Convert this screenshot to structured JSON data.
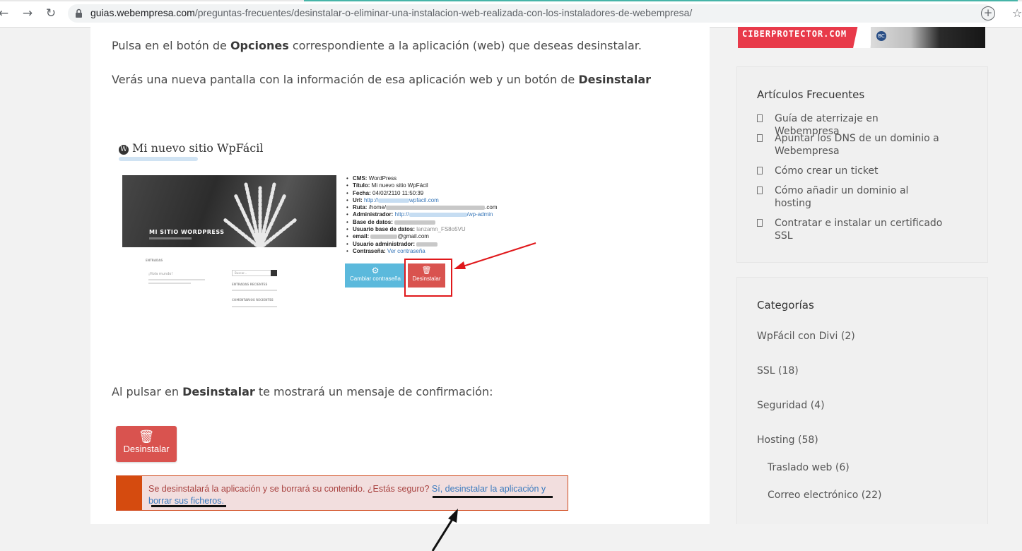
{
  "browser": {
    "url_host": "guias.webempresa.com",
    "url_path": "/preguntas-frecuentes/desinstalar-o-eliminar-una-instalacion-web-realizada-con-los-instaladores-de-webempresa/"
  },
  "article": {
    "p1": {
      "before": "Pulsa en el botón de ",
      "bold": "Opciones",
      "after": " correspondiente a la aplicación (web) que deseas desinstalar."
    },
    "p2": {
      "before": "Verás una nueva pantalla con la información de esa aplicación web y un botón de ",
      "bold": "Desinstalar"
    },
    "p3": {
      "before": "Al pulsar en ",
      "bold": "Desinstalar",
      "after": " te mostrará un mensaje de confirmación:"
    }
  },
  "screenshot1": {
    "site_title": "Mi nuevo sitio WpFácil",
    "hero_caption": "MI SITIO WORDPRESS",
    "mini": {
      "entradas": "ENTRADAS",
      "post_title": "¡Hola mundo!",
      "recent": "ENTRADAS RECIENTES",
      "comments": "COMENTARIOS RECIENTES",
      "search": "Buscar..."
    },
    "info": {
      "cms_label": "CMS:",
      "cms_value": "WordPress",
      "titulo_label": "Título:",
      "titulo_value": "Mi nuevo sitio WpFácil",
      "fecha_label": "Fecha:",
      "fecha_value": "04/02/2110 11:50:39",
      "url_label": "Url:",
      "url_pre": "http://",
      "url_post": "wpfacil.com",
      "ruta_label": "Ruta:",
      "ruta_pre": "/home/",
      "ruta_post": ".com",
      "admin_label": "Administrador:",
      "admin_pre": "http://",
      "admin_post": "/wp-admin",
      "bd_label": "Base de datos:",
      "ubd_label": "Usuario base de datos:",
      "ubd_value": "lanzamn_FS8o5VU",
      "email_label": "email:",
      "email_value": "@gmail.com",
      "uadmin_label": "Usuario administrador:",
      "pass_label": "Contraseña:",
      "pass_link": "Ver contraseña"
    },
    "btn_cambiar": "Cambiar contraseña",
    "btn_desinstalar": "Desinstalar"
  },
  "screenshot2": {
    "btn_desinstalar": "Desinstalar",
    "alert_text": "Se desinstalará la aplicación y se borrará su contenido. ¿Estás seguro? ",
    "alert_link": "Sí, desinstalar la aplicación y borrar sus ficheros."
  },
  "sidebar": {
    "ad_text": "CIBERPROTECTOR.COM",
    "faq": {
      "title": "Artículos Frecuentes",
      "items": [
        "Guía de aterrizaje en Webempresa",
        "Apuntar los DNS de un dominio a Webempresa",
        "Cómo crear un ticket",
        "Cómo añadir un dominio al hosting",
        "Contratar e instalar un certificado SSL"
      ]
    },
    "categories": {
      "title": "Categorías",
      "items": [
        "WpFácil con Divi (2)",
        "SSL (18)",
        "Seguridad (4)",
        "Hosting (58)",
        "Traslado web (6)",
        "Correo electrónico (22)"
      ]
    }
  },
  "colors": {
    "accent_red": "#d9534f",
    "highlight_red": "#e0181b",
    "link_blue": "#3b7bbf",
    "alert_bg": "#f2dede",
    "tab_accent": "#46b4a8"
  },
  "icons": [
    "back-arrow-icon",
    "forward-arrow-icon",
    "reload-icon",
    "lock-icon",
    "add-icon",
    "star-icon",
    "gear-icon",
    "trash-icon",
    "wordpress-logo-icon",
    "square-bullet-icon",
    "arrow-pointer-icon"
  ]
}
